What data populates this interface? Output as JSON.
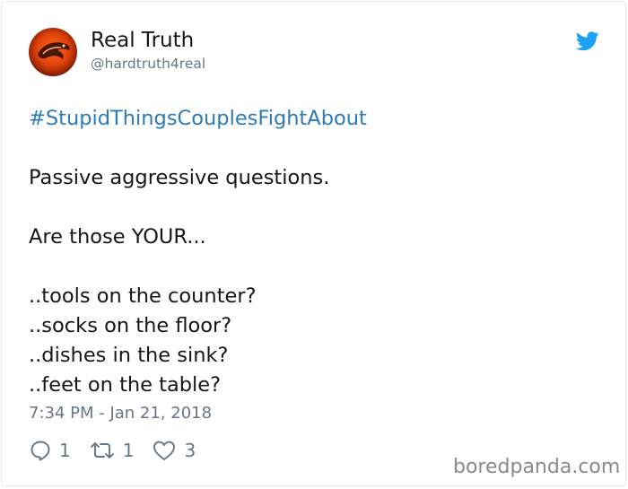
{
  "author": {
    "display_name": "Real Truth",
    "handle": "@hardtruth4real",
    "avatar_icon": "dragon-logo-avatar"
  },
  "brand_icon": "twitter-bird-icon",
  "tweet": {
    "hashtag": "#StupidThingsCouplesFightAbout",
    "lines": [
      "Passive aggressive questions.",
      "Are those YOUR...",
      "..tools on the counter?",
      "..socks on the floor?",
      "..dishes in the sink?",
      "..feet on the table?"
    ],
    "timestamp": "7:34 PM - Jan 21, 2018"
  },
  "actions": {
    "replies": "1",
    "retweets": "1",
    "likes": "3"
  },
  "watermark": "boredpanda.com",
  "colors": {
    "link": "#2b7bb9",
    "twitter_blue": "#1da1f2",
    "muted": "#657786"
  }
}
